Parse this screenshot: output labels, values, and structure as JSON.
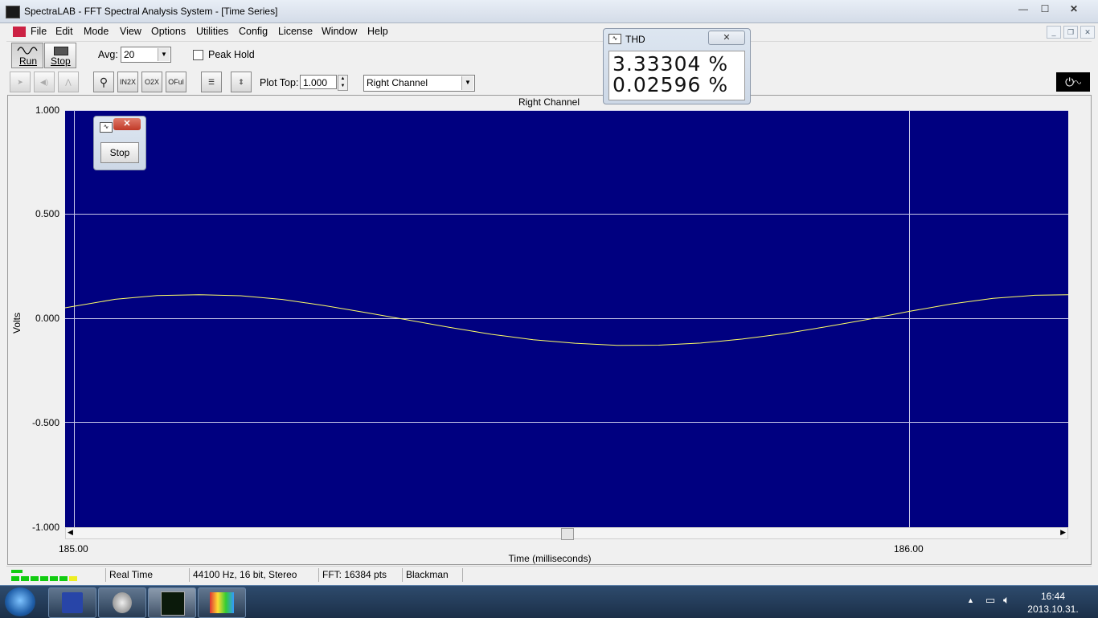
{
  "window": {
    "title": "SpectraLAB - FFT Spectral Analysis System - [Time Series]",
    "min": "—",
    "max": "☐",
    "close": "✕"
  },
  "menu": [
    "File",
    "Edit",
    "Mode",
    "View",
    "Options",
    "Utilities",
    "Config",
    "License",
    "Window",
    "Help"
  ],
  "toolbar1": {
    "run_label": "Run",
    "stop_label": "Stop",
    "avg_label": "Avg:",
    "avg_value": "20",
    "peak_hold_label": "Peak Hold"
  },
  "toolbar2": {
    "plot_top_label": "Plot Top:",
    "plot_top_value": "1.000",
    "channel_value": "Right Channel",
    "icons": [
      "pointer-icon",
      "speaker-icon",
      "peak-icon",
      "zoom-icon",
      "zoom-in-2x-icon",
      "zoom-out-2x-icon",
      "zoom-out-full-icon",
      "settings-panel-icon",
      "scale-icon"
    ]
  },
  "thd": {
    "title": "THD",
    "value1": "3.33304 %",
    "value2": "0.02596 %"
  },
  "mini_window": {
    "stop_label": "Stop"
  },
  "plot": {
    "title": "Right Channel",
    "ylabel": "Volts",
    "xlabel": "Time (milliseconds)",
    "trace_color": "#ffff66",
    "bg_color": "#000080"
  },
  "chart_data": {
    "type": "line",
    "title": "Right Channel",
    "xlabel": "Time (milliseconds)",
    "ylabel": "Volts",
    "ylim": [
      -1.0,
      1.0
    ],
    "xlim": [
      184.99,
      186.19
    ],
    "yticks": [
      "1.000",
      "0.500",
      "0.000",
      "-0.500",
      "-1.000"
    ],
    "xticks": [
      "185.00",
      "186.00"
    ],
    "grid": true,
    "series": [
      {
        "x": [
          184.99,
          185.05,
          185.1,
          185.15,
          185.2,
          185.25,
          185.3,
          185.35,
          185.4,
          185.45,
          185.5,
          185.55,
          185.6,
          185.65,
          185.7,
          185.75,
          185.8,
          185.85,
          185.9,
          185.95,
          186.0,
          186.05,
          186.1,
          186.15,
          186.19
        ],
        "y": [
          0.052,
          0.093,
          0.111,
          0.115,
          0.11,
          0.092,
          0.063,
          0.029,
          -0.006,
          -0.042,
          -0.075,
          -0.101,
          -0.118,
          -0.128,
          -0.127,
          -0.117,
          -0.098,
          -0.072,
          -0.039,
          -0.004,
          0.035,
          0.07,
          0.097,
          0.112,
          0.115
        ]
      }
    ]
  },
  "status": {
    "mode": "Real Time",
    "format": "44100 Hz, 16 bit, Stereo",
    "fft": "FFT: 16384 pts",
    "window": "Blackman"
  },
  "taskbar": {
    "time": "16:44",
    "date": "2013.10.31."
  }
}
